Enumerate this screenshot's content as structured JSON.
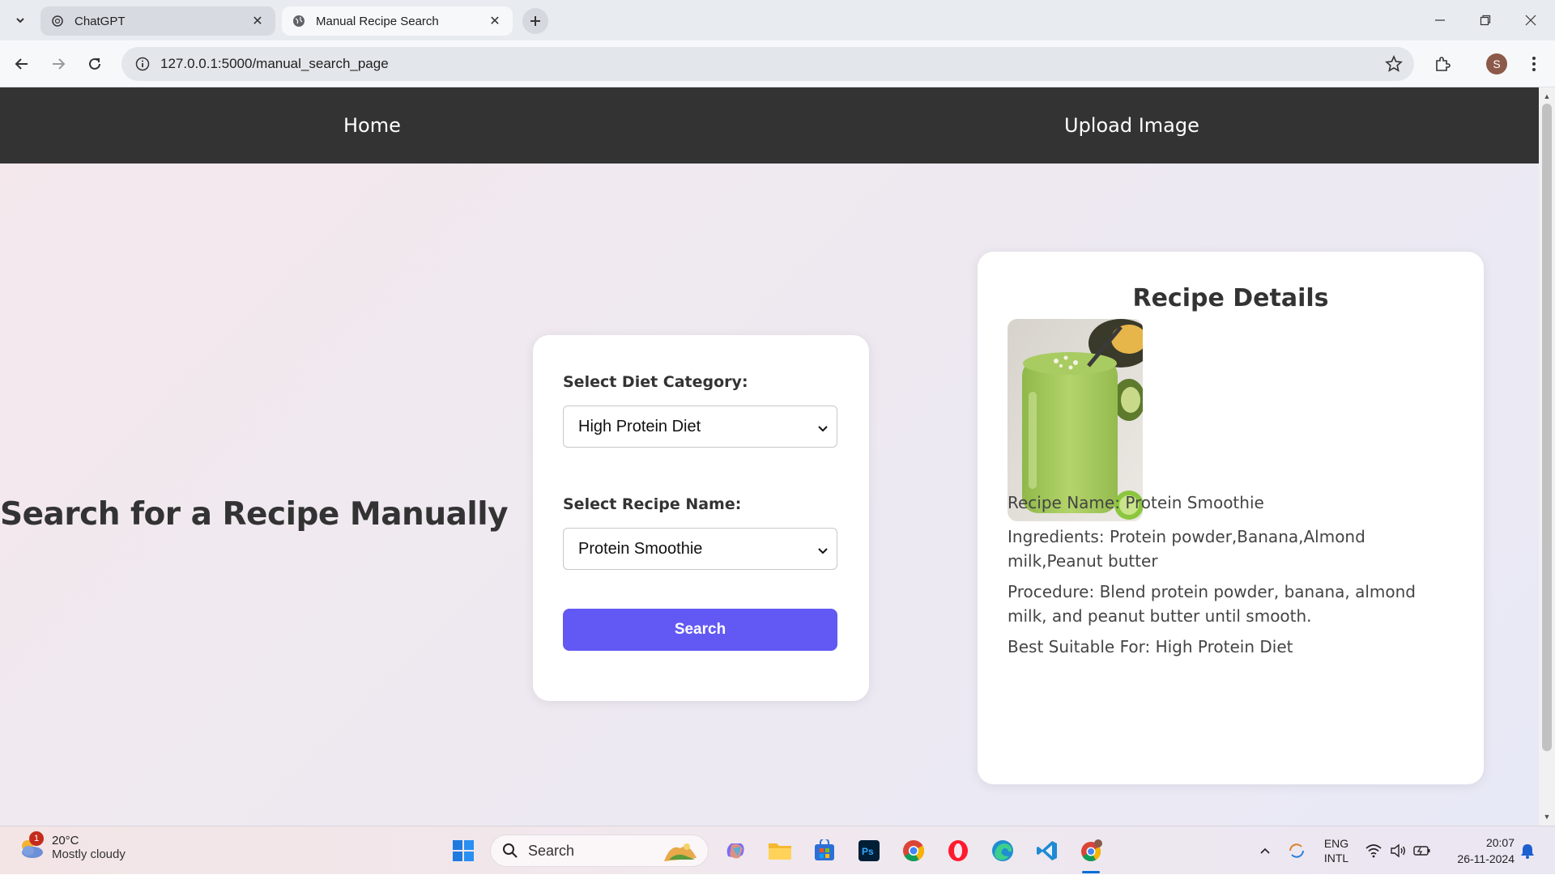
{
  "browser": {
    "tabs": [
      {
        "title": "ChatGPT",
        "active": false
      },
      {
        "title": "Manual Recipe Search",
        "active": true
      }
    ],
    "url": "127.0.0.1:5000/manual_search_page",
    "profile_initial": "S"
  },
  "nav": {
    "home": "Home",
    "upload": "Upload Image"
  },
  "page": {
    "heading": "Search for a Recipe Manually"
  },
  "form": {
    "diet_label": "Select Diet Category:",
    "diet_value": "High Protein Diet",
    "recipe_label": "Select Recipe Name:",
    "recipe_value": "Protein Smoothie",
    "search_button": "Search"
  },
  "details": {
    "title": "Recipe Details",
    "name_line": "Recipe Name: Protein Smoothie",
    "ingredients_line": "Ingredients: Protein powder,Banana,Almond milk,Peanut butter",
    "procedure_line": "Procedure: Blend protein powder, banana, almond milk, and peanut butter until smooth.",
    "suitable_line": "Best Suitable For: High Protein Diet"
  },
  "taskbar": {
    "weather_temp": "20°C",
    "weather_cond": "Mostly cloudy",
    "weather_badge": "1",
    "search_placeholder": "Search",
    "lang_top": "ENG",
    "lang_bottom": "INTL",
    "time": "20:07",
    "date": "26-11-2024"
  },
  "colors": {
    "nav_bg": "#333333",
    "button": "#6258f3"
  }
}
